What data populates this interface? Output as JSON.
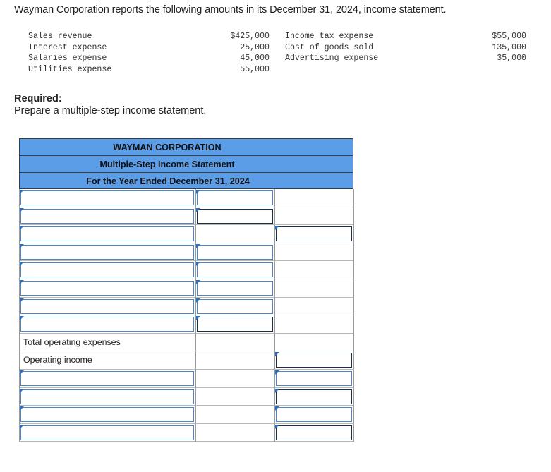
{
  "intro": "Wayman Corporation reports the following amounts in its December 31, 2024, income statement.",
  "amounts_left": [
    {
      "label": "Sales revenue",
      "value": "$425,000"
    },
    {
      "label": "Interest expense",
      "value": "25,000"
    },
    {
      "label": "Salaries expense",
      "value": "45,000"
    },
    {
      "label": "Utilities expense",
      "value": "55,000"
    }
  ],
  "amounts_right": [
    {
      "label": "Income tax expense",
      "value": "$55,000"
    },
    {
      "label": "Cost of goods sold",
      "value": "135,000"
    },
    {
      "label": "Advertising expense",
      "value": "35,000"
    }
  ],
  "required": {
    "heading": "Required:",
    "text": "Prepare a multiple-step income statement."
  },
  "statement": {
    "company": "WAYMAN CORPORATION",
    "title": "Multiple-Step Income Statement",
    "period": "For the Year Ended December 31, 2024",
    "labels": {
      "total_operating_expenses": "Total operating expenses",
      "operating_income": "Operating income"
    }
  }
}
